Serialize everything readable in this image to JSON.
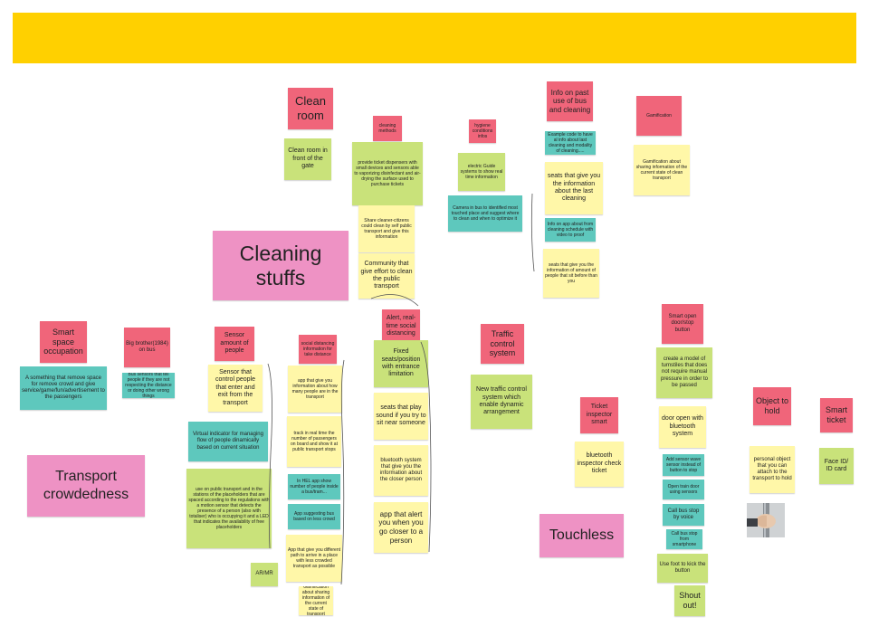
{
  "banner": {
    "color": "#ffd000"
  },
  "notes": {
    "clean_room": "Clean room",
    "clean_room_gate": "Clean room in front of the gate",
    "cleaning_methods": "cleaning methods",
    "ticket_dispensers": "provide ticket dispensers with small devices and sensors able to vaporizing disinfectant and air-drying the surface used to purchase tickets",
    "share_cleaner": "Share cleaner-citizens could clean by self public transport and give this information",
    "community": "Community that give effort to clean the public transport",
    "hygiene_conditions": "hygiene conditions infos",
    "electric_guide": "electric Guide systems to show real time information",
    "camera_bus": "Camera in bus to identified most touched place and suggest where to clean and when to optimize it",
    "info_past_use": "Info on past use of bus and cleaning",
    "example_code": "Example code to have al info about last cleaning and modality of cleaning.....",
    "seats_last_cleaning": "seats that give you the information about the last cleaning",
    "info_app": "Info on app about from cleaning schedule with video to proof",
    "seats_amount": "seats that give you the information of amount of people that sit before than you",
    "gamification": "Gamification",
    "gamification_info": "Gamification about sharing information of the current state of clean transport",
    "cleaning_stuffs": "Cleaning stuffs",
    "smart_space": "Smart space occupation",
    "remove_space": "A something that remove space for remove crowd and give service/game/fun/advertisement to the passengers",
    "big_brother": "Big brother(1984) on bus",
    "big_brother_desc": "Bus sensors that tell people if they are not respecting the distance or doing other wrong things",
    "transport_crowdedness": "Transport crowdedness",
    "sensor_amount": "Sensor amount of people",
    "sensor_control": "Sensor that control people that enter and exit from the transport",
    "virtual_indicator": "Virtual indicator for managing flow of people dinamically based on current situation",
    "use_on_public": "use on public transport and in the stations of the placeholders that are spaced according to the regulations with a motion sensor that detects the presence of a person (also with totaliser) who is occupying it and a LED that indicates the availability of free placeholders",
    "ar_mr": "AR/MR",
    "social_distancing": "social distancing information for take distance",
    "app_how_many": "app that give you information about how many people are in the transport",
    "track_realtime": "track in real time the number of passengers on board and show it at public transport stops",
    "hel_app": "In HEL app show number of people inside a bus/tram...",
    "app_suggesting": "App suggesting bus based on less crowd",
    "app_different_path": "App that give you different path to arrive in a place with less crowded transport as possible",
    "gamification_small": "Gamification about sharing information of the current state of transport",
    "alert_realtime": "Alert, real-time social distancing",
    "fixed_seats": "Fixed seats/position with entrance limitation",
    "seats_play_sound": "seats that play sound if you try to sit near someone",
    "bluetooth_system": "bluetooth system that give you the information about the closer person",
    "app_alert": "app that alert you when you go closer to a person",
    "traffic_control": "Traffic control system",
    "new_traffic": "New traffic control system which enable dynamic arrangement",
    "ticket_inspector": "Ticket inspector smart",
    "bluetooth_inspector": "bluetooth inspector check ticket",
    "touchless": "Touchless",
    "smart_open_door": "Smart open door/stop button",
    "model_turnstiles": "create a model of turnstiles that does not require manual pressure in order to be passed",
    "door_bluetooth": "door open with bluetooth system",
    "add_sensor_wave": "Add sensor wave sensor instead of button to stop",
    "open_train_door": "Open train door using sensors",
    "call_bus_voice": "Call bus stop by voice",
    "call_bus_phone": "Call bus stop from smartphone",
    "use_foot": "Use foot to kick the button",
    "shout_out": "Shout out!",
    "object_to_hold": "Object to hold",
    "personal_object": "personal object that you can attach to the transport to hold",
    "smart_ticket": "Smart ticket",
    "face_id": "Face ID/ ID card"
  },
  "colors": {
    "red": "#f0657a",
    "yellow": "#fff7a8",
    "green": "#c9e27a",
    "teal": "#5ec8bd",
    "pink": "#ee92c4"
  }
}
